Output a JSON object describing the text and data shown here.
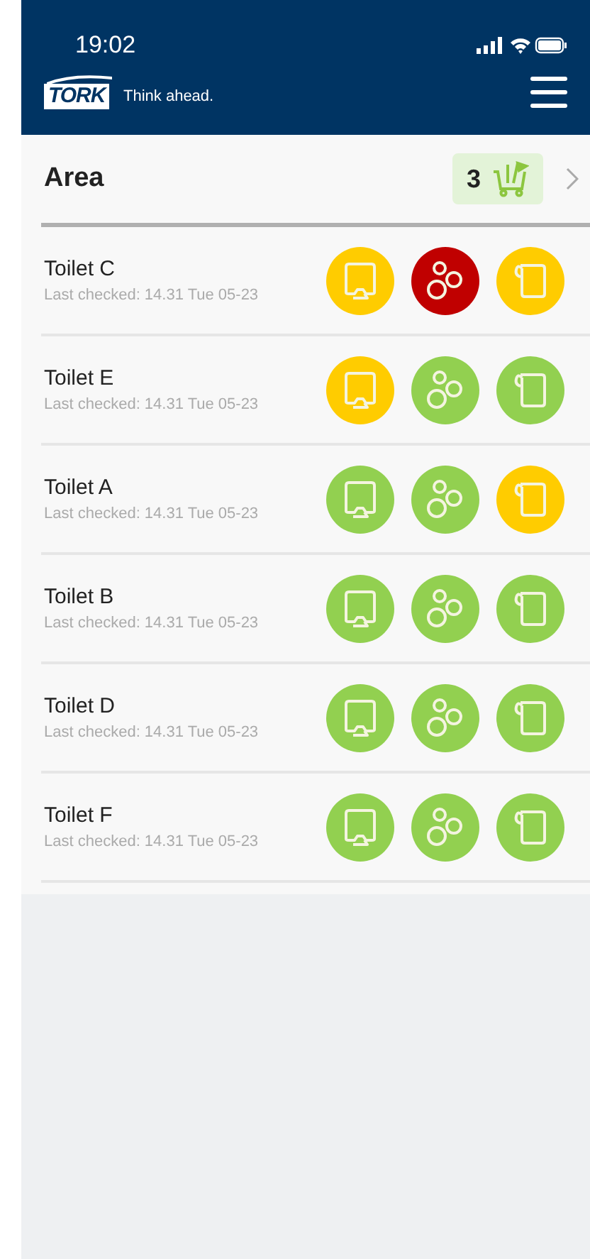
{
  "status_bar": {
    "time": "19:02"
  },
  "header": {
    "slogan": "Think ahead.",
    "logo": "TORK"
  },
  "area": {
    "title": "Area",
    "cart_count": "3"
  },
  "toilets": [
    {
      "name": "Toilet C",
      "last_checked": "Last checked: 14.31 Tue 05-23",
      "dispensers": [
        {
          "kind": "hand",
          "color": "#ffcc00"
        },
        {
          "kind": "soap",
          "color": "#c00000"
        },
        {
          "kind": "paper",
          "color": "#ffcc00"
        }
      ]
    },
    {
      "name": "Toilet E",
      "last_checked": "Last checked: 14.31 Tue 05-23",
      "dispensers": [
        {
          "kind": "hand",
          "color": "#ffcc00"
        },
        {
          "kind": "soap",
          "color": "#92d050"
        },
        {
          "kind": "paper",
          "color": "#92d050"
        }
      ]
    },
    {
      "name": "Toilet A",
      "last_checked": "Last checked: 14.31 Tue 05-23",
      "dispensers": [
        {
          "kind": "hand",
          "color": "#92d050"
        },
        {
          "kind": "soap",
          "color": "#92d050"
        },
        {
          "kind": "paper",
          "color": "#ffcc00"
        }
      ]
    },
    {
      "name": "Toilet B",
      "last_checked": "Last checked: 14.31 Tue 05-23",
      "dispensers": [
        {
          "kind": "hand",
          "color": "#92d050"
        },
        {
          "kind": "soap",
          "color": "#92d050"
        },
        {
          "kind": "paper",
          "color": "#92d050"
        }
      ]
    },
    {
      "name": "Toilet D",
      "last_checked": "Last checked: 14.31 Tue 05-23",
      "dispensers": [
        {
          "kind": "hand",
          "color": "#92d050"
        },
        {
          "kind": "soap",
          "color": "#92d050"
        },
        {
          "kind": "paper",
          "color": "#92d050"
        }
      ]
    },
    {
      "name": "Toilet F",
      "last_checked": "Last checked: 14.31 Tue 05-23",
      "dispensers": [
        {
          "kind": "hand",
          "color": "#92d050"
        },
        {
          "kind": "soap",
          "color": "#92d050"
        },
        {
          "kind": "paper",
          "color": "#92d050"
        }
      ]
    }
  ]
}
